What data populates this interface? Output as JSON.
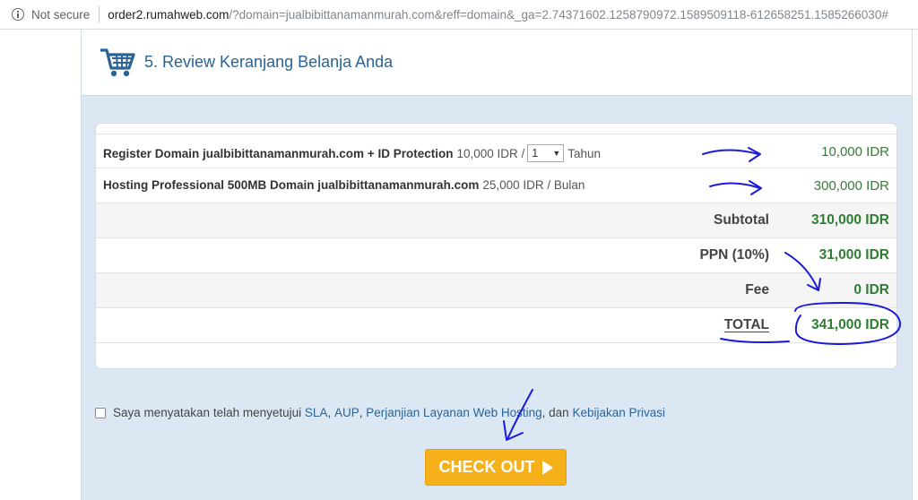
{
  "browser": {
    "security_label": "Not secure",
    "url_host": "order2.rumahweb.com",
    "url_path": "/?domain=jualbibittanamanmurah.com&reff=domain&_ga=2.74371602.1258790972.1589509118-612658251.1585266030#"
  },
  "step": {
    "title": "5. Review Keranjang Belanja Anda"
  },
  "items": [
    {
      "name": "Register Domain jualbibittanamanmurah.com + ID Protection",
      "unit_price": "10,000 IDR /",
      "qty": "1",
      "period": "Tahun",
      "total": "10,000 IDR"
    },
    {
      "name": "Hosting Professional 500MB Domain jualbibittanamanmurah.com",
      "unit_price": "25,000 IDR / Bulan",
      "total": "300,000 IDR"
    }
  ],
  "summary": {
    "subtotal_label": "Subtotal",
    "subtotal_value": "310,000 IDR",
    "tax_label": "PPN (10%)",
    "tax_value": "31,000 IDR",
    "fee_label": "Fee",
    "fee_value": "0 IDR",
    "total_label": "TOTAL",
    "total_value": "341,000 IDR"
  },
  "terms": {
    "prefix": "Saya menyatakan telah menyetujui",
    "sla": "SLA",
    "sep1": ",",
    "aup": "AUP",
    "sep2": ",",
    "service_agreement": "Perjanjian Layanan Web Hosting",
    "conj": ", dan",
    "privacy": "Kebijakan Privasi"
  },
  "checkout": {
    "label": "CHECK OUT"
  },
  "colors": {
    "accent_blue": "#2a6496",
    "price_green": "#2e7d32",
    "checkout_orange": "#f6b019",
    "panel_bg": "#dbe8f3",
    "annotation_ink": "#1a1adb"
  },
  "icons": [
    "info-icon",
    "cart-icon",
    "play-icon",
    "dropdown-arrow-icon"
  ]
}
